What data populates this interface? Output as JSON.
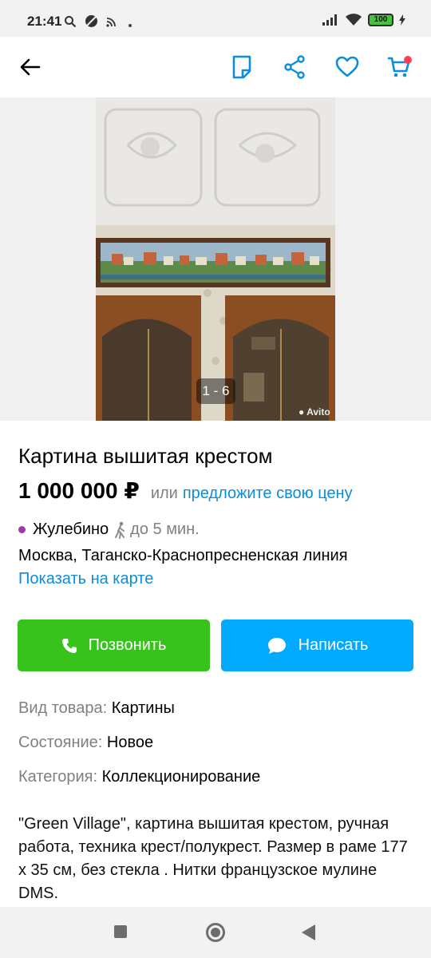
{
  "status_bar": {
    "time": "21:41",
    "battery": "100"
  },
  "colors": {
    "accent_blue": "#0a8edc",
    "call_green": "#37c21c",
    "write_blue": "#01aaff",
    "metro_line": "#9b3ba8",
    "cart_badge": "#ff4053"
  },
  "top_bar": {
    "icons": [
      "back-arrow-icon",
      "note-icon",
      "share-icon",
      "heart-icon",
      "cart-icon"
    ]
  },
  "gallery": {
    "counter": "1 - 6",
    "watermark": "Avito"
  },
  "listing": {
    "title": "Картина вышитая крестом",
    "price": "1 000 000 ₽",
    "price_or": "или",
    "price_offer": "предложите свою цену",
    "metro": "Жулебино",
    "walk_time": "до 5 мин.",
    "address": "Москва, Таганско-Краснопресненская линия",
    "map_link": "Показать на карте"
  },
  "actions": {
    "call": "Позвонить",
    "write": "Написать"
  },
  "params": [
    {
      "key": "Вид товара:",
      "value": "Картины"
    },
    {
      "key": "Состояние:",
      "value": "Новое"
    },
    {
      "key": "Категория:",
      "value": "Коллекционирование"
    }
  ],
  "description": "\"Green Village\", картина вышитая крестом, ручная работа, техника крест/полукрест. Размер в раме 177 х 35 см, без стекла . Нитки французское мулине DMS."
}
